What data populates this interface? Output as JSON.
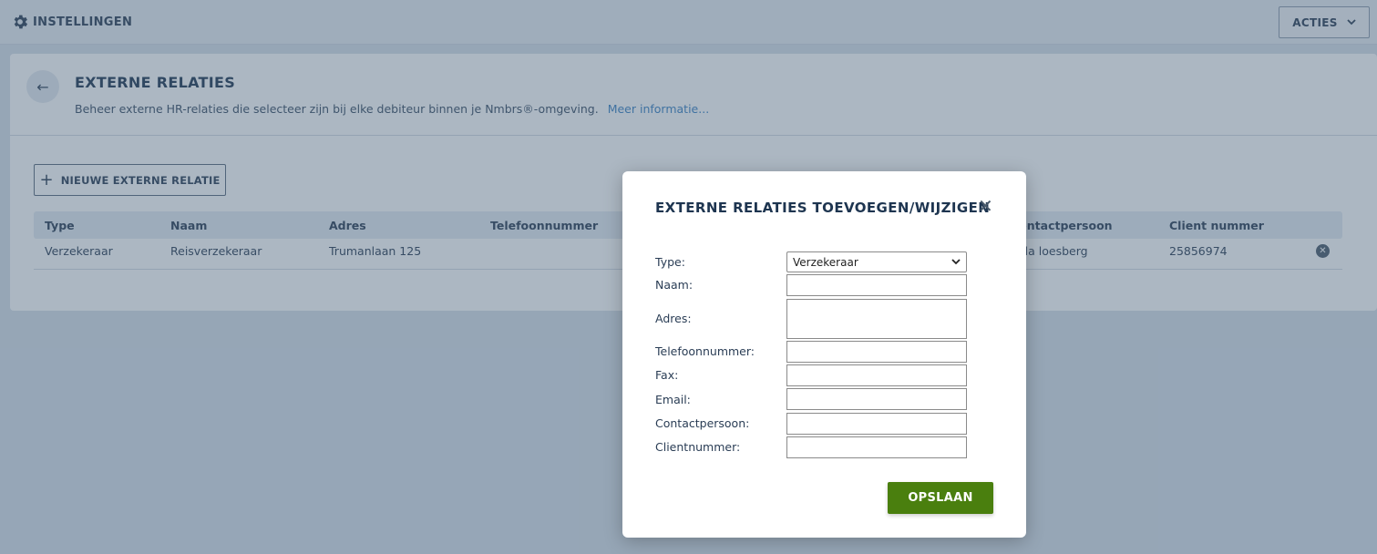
{
  "topbar": {
    "title": "INSTELLINGEN",
    "actions_label": "ACTIES"
  },
  "page": {
    "title": "EXTERNE RELATIES",
    "description": "Beheer externe HR-relaties die selecteer zijn bij elke debiteur binnen je Nmbrs®-omgeving.",
    "more_info": "Meer informatie...",
    "new_button": "NIEUWE EXTERNE RELATIE"
  },
  "table": {
    "headers": [
      "Type",
      "Naam",
      "Adres",
      "Telefoonnummer",
      "Contactpersoon",
      "Client nummer"
    ],
    "rows": [
      [
        "Verzekeraar",
        "Reisverzekeraar",
        "Trumanlaan 125",
        "",
        "Cilla loesberg",
        "25856974"
      ]
    ]
  },
  "modal": {
    "title": "EXTERNE RELATIES TOEVOEGEN/WIJZIGEN",
    "close": "✕",
    "labels": {
      "type": "Type:",
      "naam": "Naam:",
      "adres": "Adres:",
      "telefoon": "Telefoonnummer:",
      "fax": "Fax:",
      "email": "Email:",
      "contact": "Contactpersoon:",
      "client": "Clientnummer:"
    },
    "type_value": "Verzekeraar",
    "save_label": "OPSLAAN"
  },
  "icons": {
    "settings": "gear-icon",
    "back": "arrow-left-icon",
    "dropdown": "chevron-down-icon",
    "add": "plus-icon",
    "delete": "close-circle-icon"
  },
  "colors": {
    "accent": "#4a7f0e",
    "link": "#3b82c4",
    "heading": "#1e3550"
  }
}
